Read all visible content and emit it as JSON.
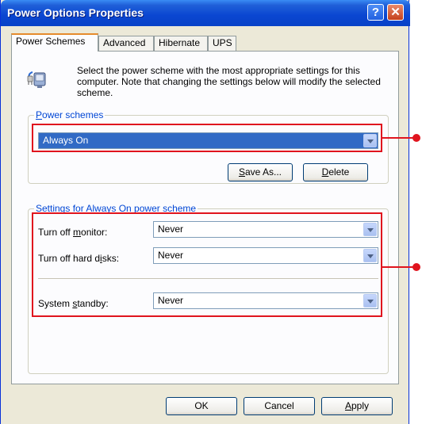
{
  "window": {
    "title": "Power Options Properties"
  },
  "title_buttons": {
    "help": "?",
    "close": "✕"
  },
  "tabs": [
    {
      "label": "Power Schemes",
      "active": true
    },
    {
      "label": "Advanced",
      "active": false
    },
    {
      "label": "Hibernate",
      "active": false
    },
    {
      "label": "UPS",
      "active": false
    }
  ],
  "intro": {
    "icon": "power-plug-computer-icon",
    "text": "Select the power scheme with the most appropriate settings for this computer. Note that changing the settings below will modify the selected scheme."
  },
  "power_schemes": {
    "group_label_accel": "P",
    "group_label_rest": "ower schemes",
    "selected": "Always On",
    "save_as_accel": "S",
    "save_as_rest": "ave As...",
    "delete_accel": "D",
    "delete_rest": "elete"
  },
  "settings": {
    "group_label": "Settings for Always On power scheme",
    "monitor": {
      "label_pre": "Turn off ",
      "label_accel": "m",
      "label_post": "onitor:",
      "value": "Never"
    },
    "hard_disks": {
      "label_pre": "Turn off hard d",
      "label_accel": "i",
      "label_post": "sks:",
      "value": "Never"
    },
    "standby": {
      "label_pre": "System ",
      "label_accel": "s",
      "label_post": "tandby:",
      "value": "Never"
    }
  },
  "footer": {
    "ok": "OK",
    "cancel": "Cancel",
    "apply_accel": "A",
    "apply_rest": "pply"
  },
  "colors": {
    "callout": "#e0141e",
    "titlebar": "#0a46d1",
    "selection": "#316ac5",
    "group_label": "#0046d5"
  }
}
